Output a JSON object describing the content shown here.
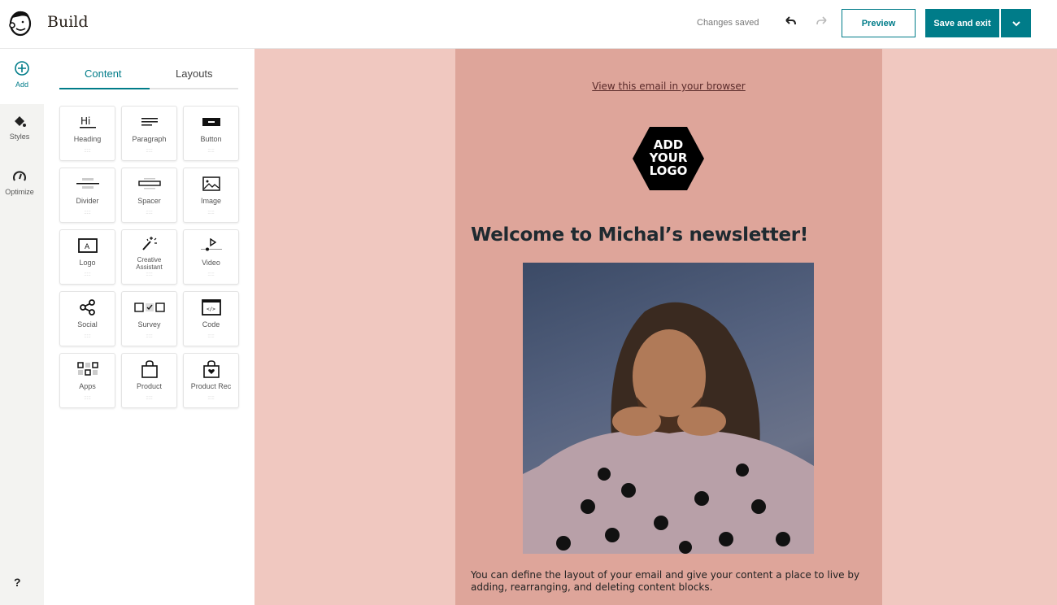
{
  "header": {
    "title": "Build",
    "status": "Changes saved",
    "preview_label": "Preview",
    "save_label": "Save and exit"
  },
  "rail": {
    "add": "Add",
    "styles": "Styles",
    "optimize": "Optimize",
    "help": "?"
  },
  "panel": {
    "tabs": [
      {
        "label": "Content",
        "active": true
      },
      {
        "label": "Layouts",
        "active": false
      }
    ],
    "blocks": [
      {
        "label": "Heading",
        "icon": "heading-icon"
      },
      {
        "label": "Paragraph",
        "icon": "paragraph-icon"
      },
      {
        "label": "Button",
        "icon": "button-icon"
      },
      {
        "label": "Divider",
        "icon": "divider-icon"
      },
      {
        "label": "Spacer",
        "icon": "spacer-icon"
      },
      {
        "label": "Image",
        "icon": "image-icon"
      },
      {
        "label": "Logo",
        "icon": "logo-icon"
      },
      {
        "label": "Creative Assistant",
        "icon": "magic-wand-icon"
      },
      {
        "label": "Video",
        "icon": "video-icon"
      },
      {
        "label": "Social",
        "icon": "share-icon"
      },
      {
        "label": "Survey",
        "icon": "survey-icon"
      },
      {
        "label": "Code",
        "icon": "code-icon"
      },
      {
        "label": "Apps",
        "icon": "apps-icon"
      },
      {
        "label": "Product",
        "icon": "shopping-bag-icon"
      },
      {
        "label": "Product Rec",
        "icon": "product-rec-icon"
      }
    ],
    "grip": ":::::"
  },
  "email": {
    "browser_link": "View this email in your browser",
    "logo_text": [
      "ADD",
      "YOUR",
      "LOGO"
    ],
    "headline": "Welcome to Michal’s newsletter!",
    "body": "You can define the layout of your email and give your content a place to live by adding, rearranging, and deleting content blocks."
  },
  "colors": {
    "accent": "#007c89",
    "canvas_bg": "#f0c8c0",
    "email_bg": "#dea59a"
  }
}
